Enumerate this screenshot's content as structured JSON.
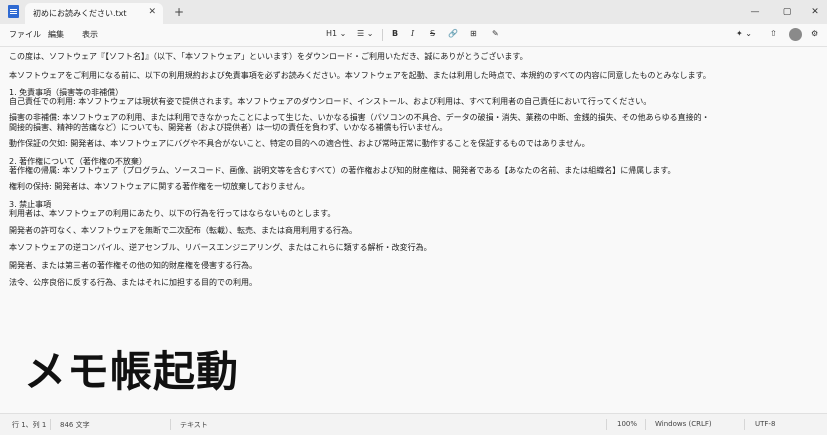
{
  "window": {
    "tab_title": "初めにお読みください.txt",
    "tab_close": "✕",
    "new_tab": "+",
    "minimize": "—",
    "maximize": "▢",
    "close": "✕"
  },
  "menu": {
    "items": [
      "ファイル",
      "編集",
      "表示"
    ]
  },
  "toolbar": {
    "heading": "H1 ⌄",
    "list": "☰ ⌄",
    "bold": "B",
    "italic": "I",
    "strike": "S",
    "link": "🔗",
    "table": "⊞",
    "clear": "✎",
    "copilot": "✦ ⌄",
    "share": "⇧",
    "settings": "⚙"
  },
  "document": {
    "lines": [
      "この度は、ソフトウェア『【ソフト名】』（以下、「本ソフトウェア」といいます）をダウンロード・ご利用いただき、誠にありがとうございます。",
      "本ソフトウェアをご利用になる前に、以下の利用規約および免責事項を必ずお読みください。本ソフトウェアを起動、または利用した時点で、本規約のすべての内容に同意したものとみなします。",
      "1. 免責事項（損害等の非補償）",
      "自己責任での利用: 本ソフトウェアは現状有姿で提供されます。本ソフトウェアのダウンロード、インストール、および利用は、すべて利用者の自己責任において行ってください。",
      "損害の非補償: 本ソフトウェアの利用、または利用できなかったことによって生じた、いかなる損害（パソコンの不具合、データの破損・消失、業務の中断、金銭的損失、その他あらゆる直接的・",
      "間接的損害、精神的苦痛など）についても、開発者（および提供者）は一切の責任を負わず、いかなる補償も行いません。",
      "動作保証の欠如: 開発者は、本ソフトウェアにバグや不具合がないこと、特定の目的への適合性、および常時正常に動作することを保証するものではありません。",
      "2. 著作権について（著作権の不放棄）",
      "著作権の帰属: 本ソフトウェア（プログラム、ソースコード、画像、説明文等を含むすべて）の著作権および知的財産権は、開発者である【あなたの名前、または組織名】に帰属します。",
      "権利の保持: 開発者は、本ソフトウェアに関する著作権を一切放棄しておりません。",
      "3. 禁止事項",
      "利用者は、本ソフトウェアの利用にあたり、以下の行為を行ってはならないものとします。",
      "開発者の許可なく、本ソフトウェアを無断で二次配布（転載）、転売、または商用利用する行為。",
      "本ソフトウェアの逆コンパイル、逆アセンブル、リバースエンジニアリング、またはこれらに類する解析・改変行為。",
      "開発者、または第三者の著作権その他の知的財産権を侵害する行為。",
      "法令、公序良俗に反する行為、またはそれに加担する目的での利用。"
    ]
  },
  "caption": "メモ帳起動",
  "status": {
    "position": "行 1、列 1",
    "chars": "846 文字",
    "format": "テキスト",
    "zoom": "100%",
    "line_ending": "Windows (CRLF)",
    "encoding": "UTF-8"
  }
}
